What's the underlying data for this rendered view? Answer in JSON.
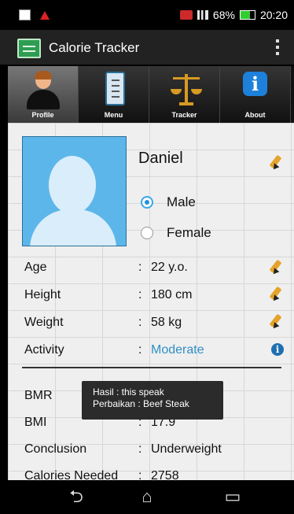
{
  "status_bar": {
    "battery_percent": "68%",
    "time": "20:20"
  },
  "app_bar": {
    "title": "Calorie Tracker"
  },
  "tabs": [
    {
      "label": "Profile",
      "active": true
    },
    {
      "label": "Menu",
      "active": false
    },
    {
      "label": "Tracker",
      "active": false
    },
    {
      "label": "About",
      "active": false
    }
  ],
  "profile": {
    "name": "Daniel",
    "gender_options": [
      {
        "label": "Male",
        "selected": true
      },
      {
        "label": "Female",
        "selected": false
      }
    ]
  },
  "rows": [
    {
      "label": "Age",
      "colon": ":",
      "value": "22 y.o."
    },
    {
      "label": "Height",
      "colon": ":",
      "value": "180 cm"
    },
    {
      "label": "Weight",
      "colon": ":",
      "value": "58 kg"
    },
    {
      "label": "Activity",
      "colon": ":",
      "value": "Moderate"
    }
  ],
  "results": [
    {
      "label": "BMR",
      "colon": "",
      "value": ""
    },
    {
      "label": "BMI",
      "colon": ":",
      "value": "17.9"
    },
    {
      "label": "Conclusion",
      "colon": ":",
      "value": "Underweight"
    },
    {
      "label": "Calories Needed",
      "colon": ":",
      "value": "2758"
    }
  ],
  "toast": {
    "line1": "Hasil : this speak",
    "line2": "Perbaikan : Beef Steak"
  },
  "navigation": {
    "back_icon": "back-icon",
    "home_icon": "home-icon",
    "recents_icon": "recent-apps-icon"
  },
  "colors": {
    "accent": "#2f8fc4",
    "photo_blue": "#5db6ea",
    "app_green": "#2e9d52"
  }
}
